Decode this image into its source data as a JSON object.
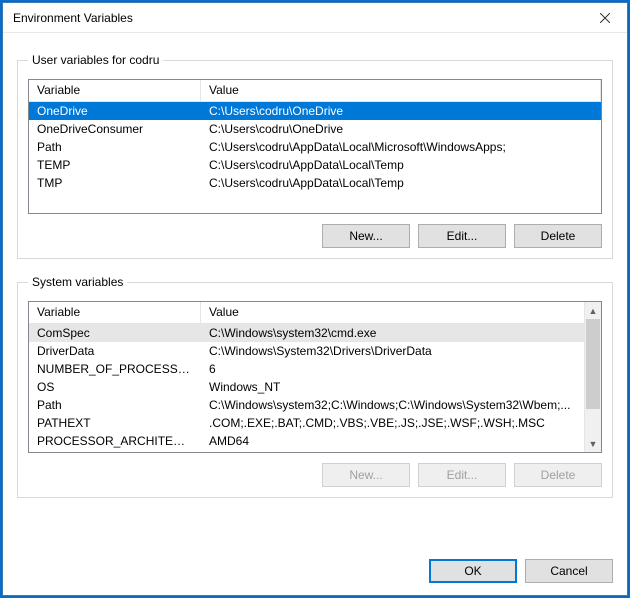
{
  "window": {
    "title": "Environment Variables"
  },
  "user": {
    "group_label": "User variables for codru",
    "header_var": "Variable",
    "header_val": "Value",
    "rows": [
      {
        "name": "OneDrive",
        "value": "C:\\Users\\codru\\OneDrive",
        "selected": true
      },
      {
        "name": "OneDriveConsumer",
        "value": "C:\\Users\\codru\\OneDrive"
      },
      {
        "name": "Path",
        "value": "C:\\Users\\codru\\AppData\\Local\\Microsoft\\WindowsApps;"
      },
      {
        "name": "TEMP",
        "value": "C:\\Users\\codru\\AppData\\Local\\Temp"
      },
      {
        "name": "TMP",
        "value": "C:\\Users\\codru\\AppData\\Local\\Temp"
      }
    ],
    "btn_new": "New...",
    "btn_edit": "Edit...",
    "btn_delete": "Delete"
  },
  "system": {
    "group_label": "System variables",
    "header_var": "Variable",
    "header_val": "Value",
    "rows": [
      {
        "name": "ComSpec",
        "value": "C:\\Windows\\system32\\cmd.exe",
        "hl": true
      },
      {
        "name": "DriverData",
        "value": "C:\\Windows\\System32\\Drivers\\DriverData"
      },
      {
        "name": "NUMBER_OF_PROCESSORS",
        "value": "6"
      },
      {
        "name": "OS",
        "value": "Windows_NT"
      },
      {
        "name": "Path",
        "value": "C:\\Windows\\system32;C:\\Windows;C:\\Windows\\System32\\Wbem;..."
      },
      {
        "name": "PATHEXT",
        "value": ".COM;.EXE;.BAT;.CMD;.VBS;.VBE;.JS;.JSE;.WSF;.WSH;.MSC"
      },
      {
        "name": "PROCESSOR_ARCHITECTURE",
        "value": "AMD64"
      }
    ],
    "btn_new": "New...",
    "btn_edit": "Edit...",
    "btn_delete": "Delete"
  },
  "footer": {
    "ok": "OK",
    "cancel": "Cancel"
  }
}
